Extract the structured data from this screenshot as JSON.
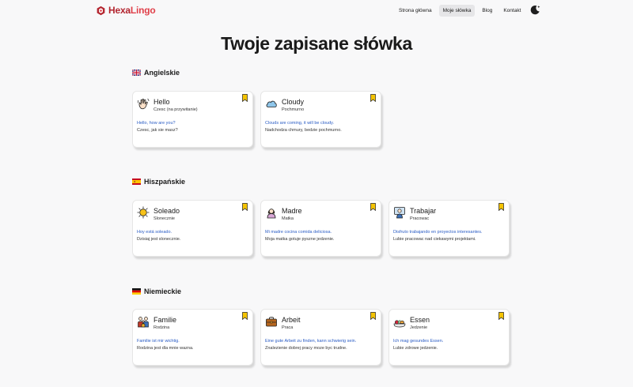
{
  "app": {
    "logo_hexa": "Hexa",
    "logo_lingo": "Lingo",
    "nav": [
      {
        "label": "Strona główna"
      },
      {
        "label": "Moje słówka"
      },
      {
        "label": "Blog"
      },
      {
        "label": "Kontakt"
      }
    ],
    "active_nav": "Moje słówka",
    "theme_icon": "moon-icon"
  },
  "page": {
    "title": "Twoje zapisane słówka"
  },
  "sections": [
    {
      "label": "Angielskie",
      "flag": "uk-flag-icon",
      "cards": [
        {
          "word": "Hello",
          "translation": "Czesc (na przywitanie)",
          "example": "Hello, how are you?",
          "example_translation": "Czesc, jak sie masz?",
          "icon": "waving-hand-icon"
        },
        {
          "word": "Cloudy",
          "translation": "Pochmurno",
          "example": "Clouds are coming, it will be cloudy.",
          "example_translation": "Nadchodza chmury, bedzie pochmurno.",
          "icon": "cloud-icon"
        }
      ]
    },
    {
      "label": "Hiszpańskie",
      "flag": "spain-flag-icon",
      "cards": [
        {
          "word": "Soleado",
          "translation": "Slonecznie",
          "example": "Hoy está soleado.",
          "example_translation": "Dzisiaj jest slonecznie.",
          "icon": "sun-icon"
        },
        {
          "word": "Madre",
          "translation": "Matka",
          "example": "Mi madre cocina comida deliciosa.",
          "example_translation": "Moja matka gotuje pyszne jedzenie.",
          "icon": "mother-icon"
        },
        {
          "word": "Trabajar",
          "translation": "Pracowac",
          "example": "Disfruto trabajando en proyectos interesantes.",
          "example_translation": "Lubie pracowac nad ciekawymi projektami.",
          "icon": "worker-icon"
        }
      ]
    },
    {
      "label": "Niemieckie",
      "flag": "germany-flag-icon",
      "cards": [
        {
          "word": "Familie",
          "translation": "Rodzina",
          "example": "Familie ist mir wichtig.",
          "example_translation": "Rodzina jest dla mnie wazna.",
          "icon": "family-icon"
        },
        {
          "word": "Arbeit",
          "translation": "Praca",
          "example": "Eine gute Arbeit zu finden, kann schwierig sein.",
          "example_translation": "Znalezienie dobrej pracy moze byc trudne.",
          "icon": "briefcase-icon"
        },
        {
          "word": "Essen",
          "translation": "Jedzenie",
          "example": "Ich mag gesundes Essen.",
          "example_translation": "Lubie zdrowe jedzenie.",
          "icon": "food-icon"
        }
      ]
    }
  ],
  "colors": {
    "logo_dark": "#b3252f",
    "logo_light": "#e0404a",
    "example_blue": "#2a5cc4",
    "bookmark": "#f5c400"
  }
}
